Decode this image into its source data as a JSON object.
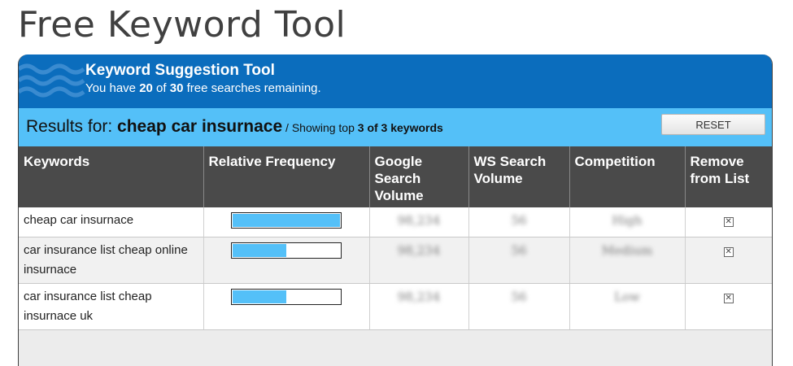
{
  "page": {
    "title": "Free Keyword Tool"
  },
  "banner": {
    "title": "Keyword Suggestion Tool",
    "remaining_prefix": "You have ",
    "remaining_used": "20",
    "remaining_of": " of ",
    "remaining_total": "30",
    "remaining_suffix": " free searches remaining."
  },
  "results": {
    "label": "Results for: ",
    "query": "cheap car insurnace",
    "showing_prefix": " / Showing top ",
    "showing_count": "3 of 3 keywords",
    "reset_label": "RESET"
  },
  "table": {
    "headers": {
      "keywords": "Keywords",
      "frequency": "Relative Frequency",
      "google": "Google Search Volume",
      "ws": "WS Search Volume",
      "competition": "Competition",
      "remove": "Remove from List"
    },
    "rows": [
      {
        "keyword": "cheap car insurnace",
        "frequency": 1.0,
        "google": "98,234",
        "ws": "56",
        "competition": "High",
        "remove_icon": "close-box-icon",
        "remove_glyph": "✕"
      },
      {
        "keyword": "car insurance list cheap online insurnace",
        "frequency": 0.5,
        "google": "98,234",
        "ws": "56",
        "competition": "Medium",
        "remove_icon": "close-box-icon",
        "remove_glyph": "✕"
      },
      {
        "keyword": "car insurance list cheap insurnace uk",
        "frequency": 0.5,
        "google": "98,234",
        "ws": "56",
        "competition": "Low",
        "remove_icon": "close-box-icon",
        "remove_glyph": "✕"
      }
    ]
  },
  "colors": {
    "banner": "#0b6dbd",
    "results_bar": "#54c0f8",
    "header_bg": "#4a4a4a",
    "bar_fill": "#54c0f8"
  }
}
